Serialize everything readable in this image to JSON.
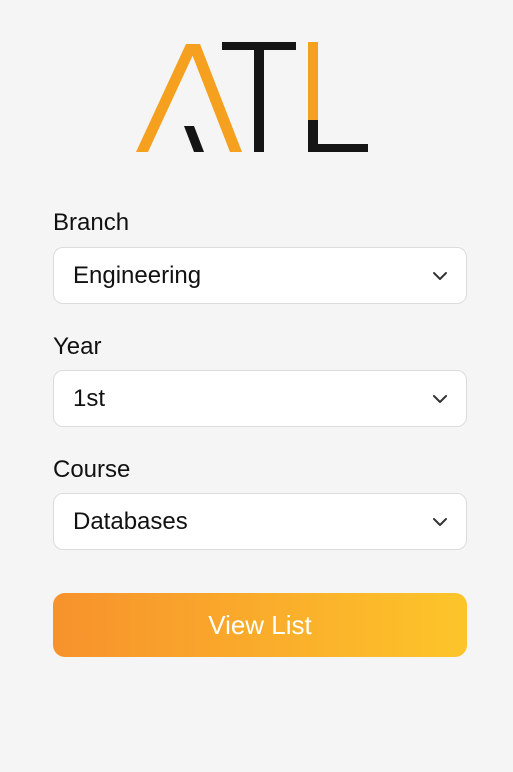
{
  "logo": {
    "text": "ATL",
    "colors": {
      "orange": "#f5a01e",
      "dark": "#151515"
    }
  },
  "form": {
    "branch": {
      "label": "Branch",
      "value": "Engineering",
      "icon": "chevron-down-icon"
    },
    "year": {
      "label": "Year",
      "value": "1st",
      "icon": "chevron-down-icon"
    },
    "course": {
      "label": "Course",
      "value": "Databases",
      "icon": "chevron-down-icon"
    }
  },
  "button": {
    "label": "View List",
    "gradient_start": "#f7922c",
    "gradient_end": "#fdc52a"
  }
}
